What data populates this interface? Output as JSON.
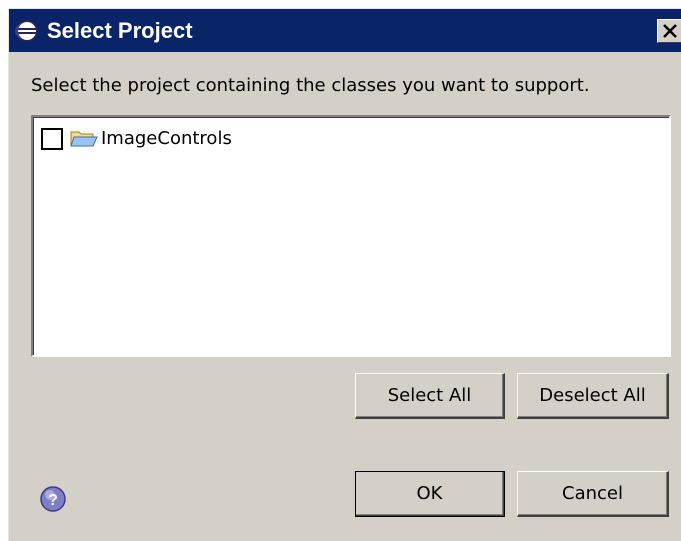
{
  "dialog": {
    "title": "Select Project",
    "instruction": "Select the project containing the classes you want to support.",
    "close_icon": "close-icon",
    "title_icon": "eclipse-icon"
  },
  "tree": {
    "items": [
      {
        "label": "ImageControls",
        "checked": false,
        "icon": "folder-open-icon"
      }
    ]
  },
  "buttons": {
    "select_all": "Select All",
    "deselect_all": "Deselect All",
    "ok": "OK",
    "cancel": "Cancel"
  },
  "help": {
    "icon": "help-icon"
  },
  "colors": {
    "titlebar": "#0a246a",
    "dialog_bg": "#d4d0c8",
    "title_text": "#ffffff"
  }
}
